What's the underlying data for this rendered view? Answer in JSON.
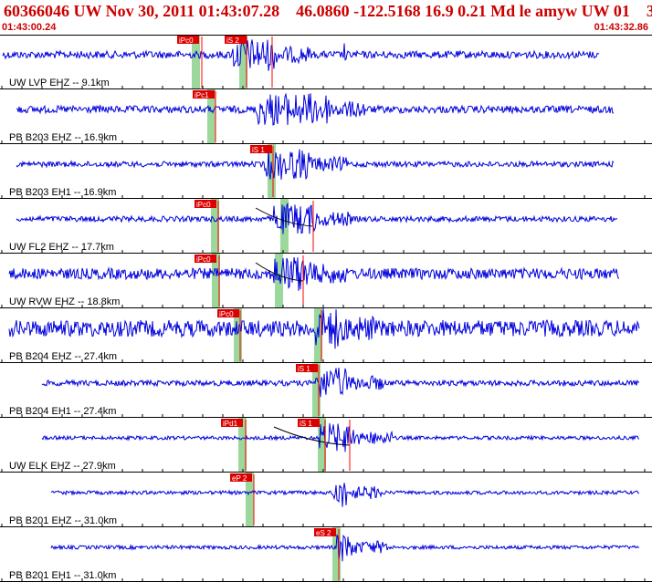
{
  "header": {
    "title": "60366046 UW Nov 30, 2011 01:43:07.28    46.0860 -122.5168 16.9 0.21 Md le amyw UW 01    3",
    "start_time": "01:43:00.24",
    "end_time": "01:43:32.86"
  },
  "colors": {
    "header_text": "#cc0000",
    "trace": "#0000dd",
    "pick_box": "#dd0000",
    "pick_band": "#9cd89c",
    "pick_line": "#ff0000",
    "frame": "#000000"
  },
  "traces": [
    {
      "label": "UW LVP EHZ -- 9.1km",
      "picks": [
        "iPc0",
        "iS 2"
      ]
    },
    {
      "label": "PB B203 EHZ -- 16.9km",
      "picks": [
        "iPc1"
      ]
    },
    {
      "label": "PB B203 EH1 -- 16.9km",
      "picks": [
        "iS 1"
      ]
    },
    {
      "label": "UW FL2 EHZ -- 17.7km",
      "picks": [
        "iPc0"
      ]
    },
    {
      "label": "UW RVW EHZ -- 18.8km",
      "picks": [
        "iPc0"
      ]
    },
    {
      "label": "PB B204 EHZ -- 27.4km",
      "picks": [
        "iPc0"
      ]
    },
    {
      "label": "PB B204 EH1 -- 27.4km",
      "picks": [
        "iS 1"
      ]
    },
    {
      "label": "UW ELK EHZ -- 27.9km",
      "picks": [
        "iPd1",
        "iS 1"
      ]
    },
    {
      "label": "PB B201 EHZ -- 31.0km",
      "picks": [
        "eP 2"
      ]
    },
    {
      "label": "PB B201 EH1 -- 31.0km",
      "picks": [
        "eS 2"
      ]
    }
  ]
}
